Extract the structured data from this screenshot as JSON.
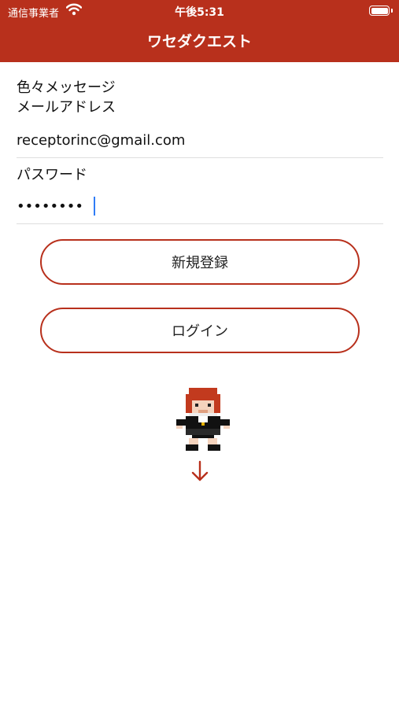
{
  "status_bar": {
    "carrier": "通信事業者",
    "time": "午後5:31",
    "icons": [
      "wifi-icon",
      "battery-icon"
    ]
  },
  "nav": {
    "title": "ワセダクエスト"
  },
  "form": {
    "message": "色々メッセージ\nメールアドレス",
    "email_value": "receptorinc@gmail.com",
    "password_label": "パスワード",
    "password_value": "••••••••"
  },
  "buttons": {
    "register": "新規登録",
    "login": "ログイン"
  },
  "icons": {
    "character": "pixel-character-icon",
    "arrow": "arrow-down-icon"
  },
  "colors": {
    "brand": "#b8301c",
    "caret": "#2f7cf6"
  }
}
